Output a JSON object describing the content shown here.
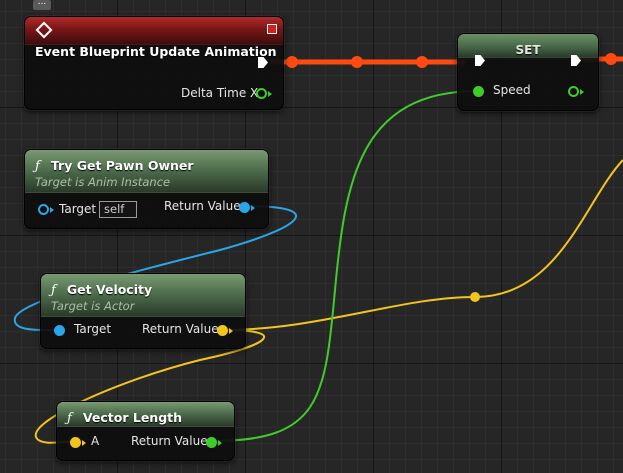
{
  "nodes": {
    "event": {
      "title": "Event Blueprint Update Animation",
      "output_pin": "Delta Time X"
    },
    "set_node": {
      "title": "SET",
      "input_pin": "Speed"
    },
    "try_get_pawn_owner": {
      "title": "Try Get Pawn Owner",
      "subtitle": "Target is Anim Instance",
      "target_label": "Target",
      "target_default": "self",
      "return_label": "Return Value"
    },
    "get_velocity": {
      "title": "Get Velocity",
      "subtitle": "Target is Actor",
      "target_label": "Target",
      "return_label": "Return Value"
    },
    "vector_length": {
      "title": "Vector Length",
      "input_label": "A",
      "return_label": "Return Value"
    }
  },
  "icons": {
    "event": "event-diamond-icon",
    "function": "function-f-icon",
    "exec": "exec-arrow-icon",
    "close": "close-square-icon",
    "comment": "comment-bubble-icon"
  },
  "colors": {
    "exec_wire": "#ff4a12",
    "object_pin": "#2aa6e6",
    "vector_pin": "#f2c51c",
    "float_pin": "#3fcc2a",
    "event_header": "#7a1616",
    "function_header": "#4f6f4e"
  }
}
